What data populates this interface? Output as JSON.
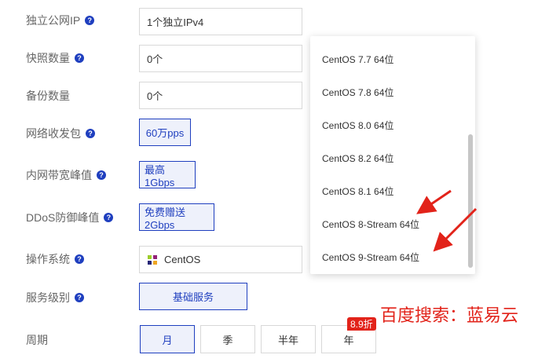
{
  "form": {
    "public_ip": {
      "label": "独立公网IP",
      "value": "1个独立IPv4"
    },
    "snapshots": {
      "label": "快照数量",
      "value": "0个"
    },
    "backups": {
      "label": "备份数量",
      "value": "0个"
    },
    "packet_rate": {
      "label": "网络收发包",
      "value": "60万pps"
    },
    "intranet_bandwidth": {
      "label": "内网带宽峰值",
      "value": "最高1Gbps"
    },
    "ddos": {
      "label": "DDoS防御峰值",
      "value": "免费赠送2Gbps"
    },
    "os": {
      "label": "操作系统",
      "value": "CentOS"
    },
    "service_level": {
      "label": "服务级别",
      "value": "基础服务"
    },
    "period": {
      "label": "周期",
      "options": [
        "月",
        "季",
        "半年",
        "年"
      ],
      "selected": "月",
      "discount_badge": "8.9折"
    }
  },
  "os_dropdown": {
    "items": [
      "CentOS 7.7 64位",
      "CentOS 7.8 64位",
      "CentOS 8.0 64位",
      "CentOS 8.2 64位",
      "CentOS 8.1 64位",
      "CentOS 8-Stream 64位",
      "CentOS 9-Stream 64位"
    ]
  },
  "watermark": "百度搜索：蓝易云",
  "help_icon_glyph": "?",
  "colors": {
    "accent": "#1f3fbf",
    "annotation_red": "#e2231a"
  },
  "icons": {
    "help": "question-circle-icon",
    "os_logo": "centos-logo-icon"
  }
}
